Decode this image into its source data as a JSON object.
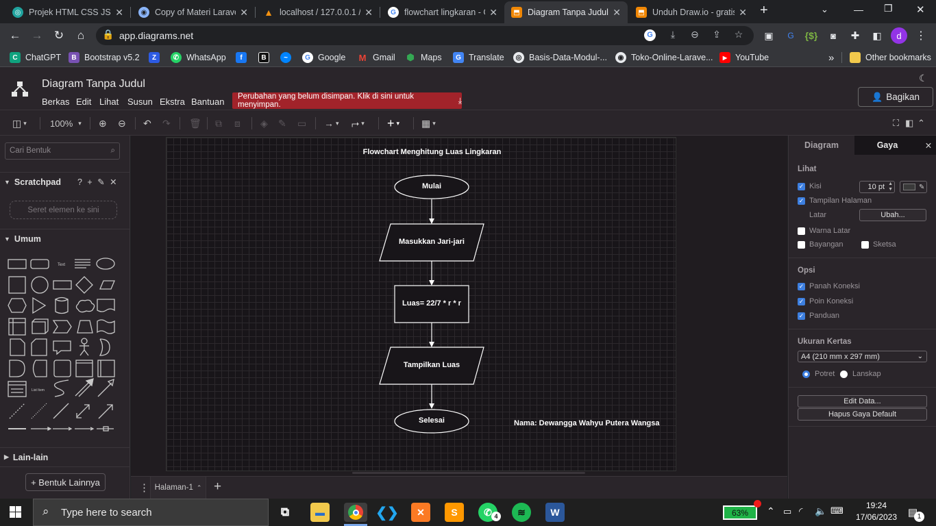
{
  "browser": {
    "tabs": [
      {
        "title": "Projek HTML CSS JS.",
        "color": "#20a39e"
      },
      {
        "title": "Copy of Materi Larave",
        "color": "#8ab4f8"
      },
      {
        "title": "localhost / 127.0.0.1 /",
        "color": "#f29111"
      },
      {
        "title": "flowchart lingkaran - G",
        "color": "#ffffff"
      },
      {
        "title": "Diagram Tanpa Judul -",
        "color": "#f08705",
        "active": true
      },
      {
        "title": "Unduh Draw.io - gratis",
        "color": "#f08705"
      }
    ],
    "new_tab_label": "+",
    "url": "app.diagrams.net",
    "profile_initial": "d",
    "bookmarks": [
      {
        "label": "ChatGPT",
        "color": "#10a37f",
        "icon": "C"
      },
      {
        "label": "Bootstrap v5.2",
        "color": "#7952b3",
        "icon": "B"
      },
      {
        "label": "",
        "color": "#2d5be3",
        "icon": "Z"
      },
      {
        "label": "WhatsApp",
        "color": "#25d366",
        "icon": "W"
      },
      {
        "label": "",
        "color": "#1877f2",
        "icon": "f"
      },
      {
        "label": "",
        "color": "#111111",
        "icon": "B"
      },
      {
        "label": "",
        "color": "#0084ff",
        "icon": "m"
      },
      {
        "label": "Google",
        "color": "#ffffff",
        "icon": "G"
      },
      {
        "label": "Gmail",
        "color": "#ea4335",
        "icon": "M"
      },
      {
        "label": "Maps",
        "color": "#34a853",
        "icon": "◆"
      },
      {
        "label": "Translate",
        "color": "#4285f4",
        "icon": "G"
      },
      {
        "label": "Basis-Data-Modul-...",
        "color": "#e8eaed",
        "icon": "◎"
      },
      {
        "label": "Toko-Online-Larave...",
        "color": "#e8eaed",
        "icon": "◎"
      },
      {
        "label": "YouTube",
        "color": "#ff0000",
        "icon": "▶"
      }
    ],
    "more_label": "»",
    "other_bookmarks": "Other bookmarks"
  },
  "app": {
    "title": "Diagram Tanpa Judul",
    "menus": [
      "Berkas",
      "Edit",
      "Lihat",
      "Susun",
      "Ekstra",
      "Bantuan"
    ],
    "unsaved_notice": "Perubahan yang belum disimpan. Klik di sini untuk menyimpan.",
    "share_label": "Bagikan",
    "zoom": "100%"
  },
  "left_panel": {
    "search_placeholder": "Cari Bentuk",
    "scratchpad_title": "Scratchpad",
    "scratchpad_tools": "? + ✎ ✕",
    "scratchpad_drop": "Seret elemen ke sini",
    "general_title": "Umum",
    "misc_title": "Lain-lain",
    "more_shapes": "+ Bentuk Lainnya"
  },
  "diagram": {
    "title": "Flowchart Menghitung Luas Lingkaran",
    "nodes": {
      "start": "Mulai",
      "input": "Masukkan Jari-jari",
      "process": "Luas= 22/7 * r * r",
      "output": "Tampilkan Luas",
      "end": "Selesai"
    },
    "author_note": "Nama: Dewangga Wahyu Putera Wangsa"
  },
  "page_bar": {
    "page_name": "Halaman-1",
    "add_label": "+"
  },
  "right_panel": {
    "tab_diagram": "Diagram",
    "tab_style": "Gaya",
    "view_section": "Lihat",
    "grid_label": "Kisi",
    "grid_size": "10 pt",
    "page_view_label": "Tampilan Halaman",
    "background_label": "Latar",
    "change_button": "Ubah...",
    "bg_color_label": "Warna Latar",
    "shadow_label": "Bayangan",
    "sketch_label": "Sketsa",
    "options_section": "Opsi",
    "conn_arrows": "Panah Koneksi",
    "conn_points": "Poin Koneksi",
    "guides": "Panduan",
    "paper_section": "Ukuran Kertas",
    "paper_value": "A4 (210 mm x 297 mm)",
    "portrait": "Potret",
    "landscape": "Lanskap",
    "edit_data": "Edit Data...",
    "reset_style": "Hapus Gaya Default"
  },
  "taskbar": {
    "search_placeholder": "Type here to search",
    "battery": "63%",
    "time": "19:24",
    "date": "17/06/2023",
    "whatsapp_badge": "4",
    "notif_count": "1"
  }
}
